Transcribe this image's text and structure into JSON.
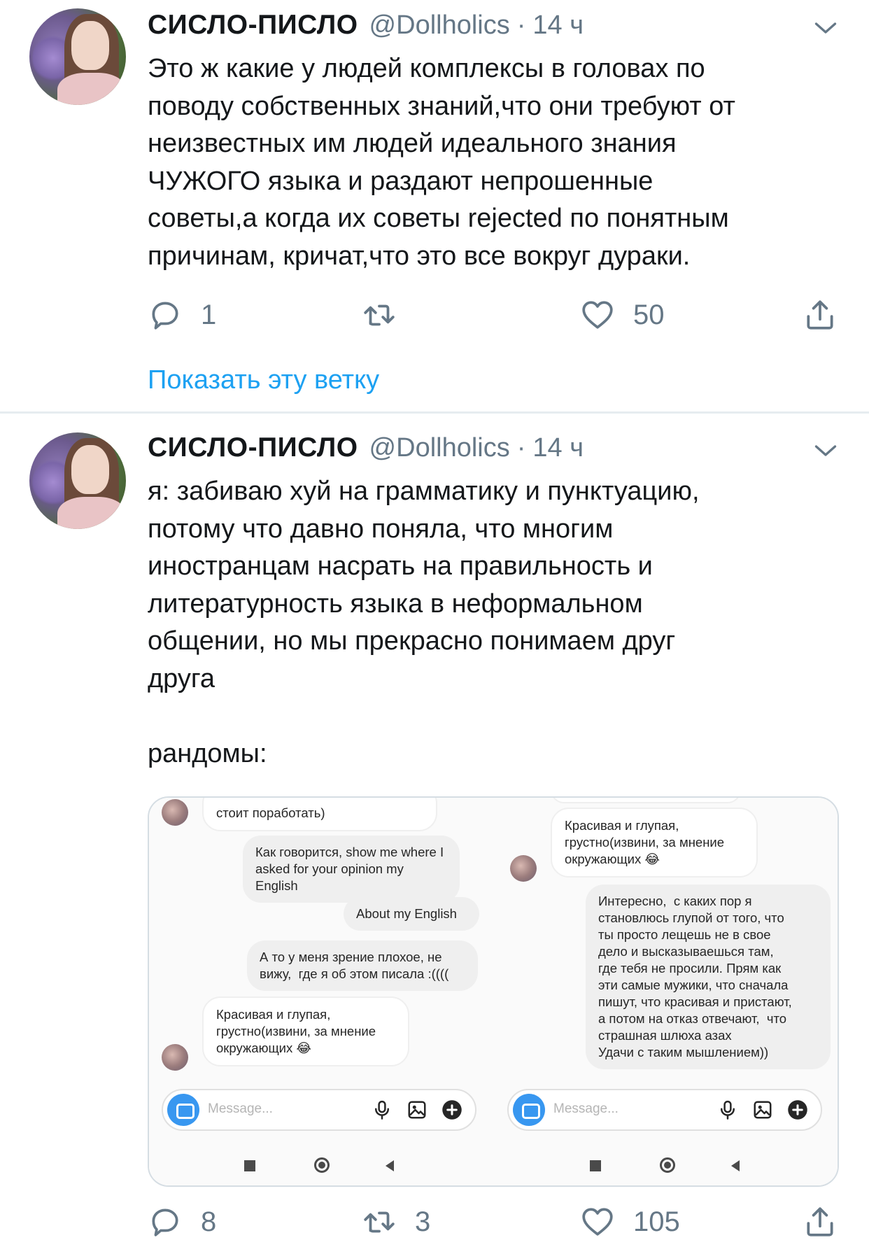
{
  "tweets": [
    {
      "author_name": "СИСЛО-ПИСЛО",
      "handle": "@Dollholics",
      "separator": "·",
      "time": "14 ч",
      "text": "Это ж какие у людей комплексы в головах по\nповоду собственных знаний,что они требуют от\nнеизвестных им людей идеального знания\nЧУЖОГО языка и раздают непрошенные\nсоветы,а когда их советы rejected по понятным\nпричинам, кричат,что это все вокруг дураки.",
      "replies": "1",
      "retweets": "",
      "likes": "50",
      "show_thread": "Показать эту ветку"
    },
    {
      "author_name": "СИСЛО-ПИСЛО",
      "handle": "@Dollholics",
      "separator": "·",
      "time": "14 ч",
      "text": "я: забиваю хуй на грамматику и пунктуацию,\nпотому что давно поняла, что многим\nиностранцам насрать на правильность и\nлитературность языка в неформальном\nобщении, но мы прекрасно понимаем друг\nдруга\n\nрандомы:",
      "replies": "8",
      "retweets": "3",
      "likes": "105"
    }
  ],
  "media": {
    "left_panel": {
      "bubble_top": "стоит поработать)",
      "bubble_2": "Как говорится, show me where I\nasked for your opinion my English",
      "bubble_3": "About my English",
      "bubble_4": "А то у меня зрение плохое, не\nвижу,  где я об этом писала :((((",
      "bubble_5": "Красивая и глупая,\nгрустно(извини, за мнение\nокружающих 😂",
      "placeholder": "Message..."
    },
    "right_panel": {
      "bubble_1": "Красивая и глупая,\nгрустно(извини, за мнение\nокружающих 😂",
      "bubble_2": "Интересно,  с каких пор я\nстановлюсь глупой от того, что\nты просто лещешь не в свое\nдело и высказываешься там,\nгде тебя не просили. Прям как\nэти самые мужики, что сначала\nпишут, что красивая и пристают,\nа потом на отказ отвечают,  что\nстрашная шлюха азах\nУдачи с таким мышлением))",
      "placeholder": "Message..."
    }
  },
  "colors": {
    "link": "#1da1f2",
    "secondary": "#657786",
    "primary_text": "#14171a",
    "separator": "#e6ecf0"
  }
}
